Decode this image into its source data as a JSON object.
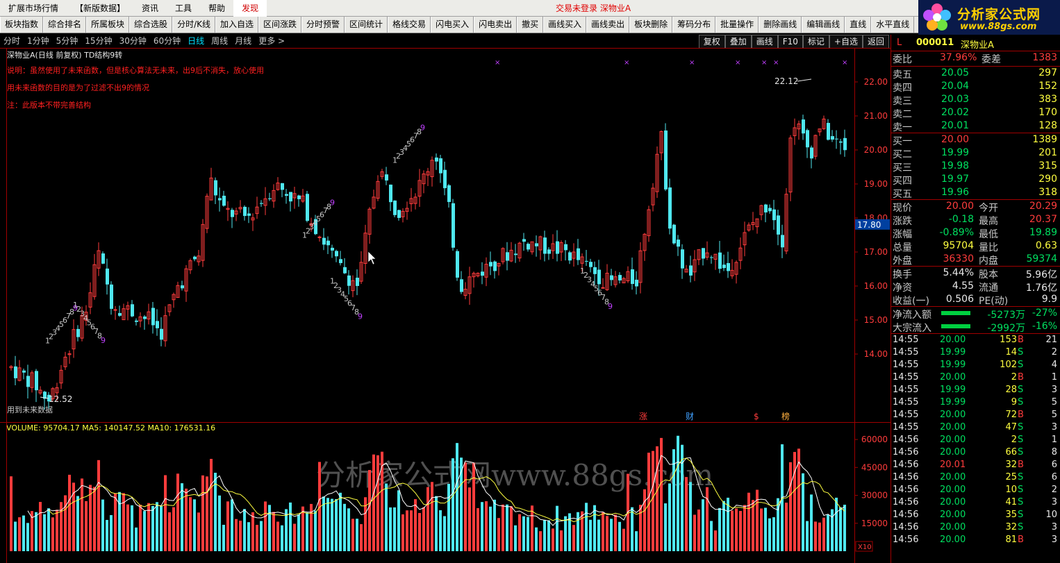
{
  "menubar": {
    "items": [
      "扩展市场行情",
      "【新版数据】",
      "资讯",
      "工具",
      "帮助",
      "发现"
    ],
    "status": "交易未登录   深物业A"
  },
  "logo": {
    "title": "分析家公式网",
    "url": "www.88gs.com"
  },
  "toolbar": [
    "板块指数",
    "综合排名",
    "所属板块",
    "综合选股",
    "分时/K线",
    "加入自选",
    "区间涨跌",
    "分时预警",
    "区间统计",
    "格线交易",
    "闪电买入",
    "闪电卖出",
    "撤买",
    "画线买入",
    "画线卖出",
    "板块删除",
    "筹码分布",
    "批量操作",
    "删除画线",
    "编辑画线",
    "直线",
    "水平直线"
  ],
  "periods": [
    "分时",
    "1分钟",
    "5分钟",
    "15分钟",
    "30分钟",
    "60分钟",
    "日线",
    "周线",
    "月线",
    "更多 >"
  ],
  "active_period": "日线",
  "right_buttons": [
    "复权",
    "叠加",
    "画线",
    "F10",
    "标记",
    "+自选",
    "返回"
  ],
  "chart": {
    "stock_title": "深物业A(日线 前复权) TD结构9转",
    "note1": "说明：虽然使用了未来函数，但是核心算法无未来，出9后不消失，放心使用",
    "note2": "用未来函数的目的是为了过滤不出9的情况",
    "note3": "注：此版本不带完善结构",
    "footer_note": "用到未来数据",
    "high_label": "22.12",
    "low_label": "12.52",
    "current_price_tag": "17.80",
    "price_axis": [
      "22.00",
      "21.00",
      "20.00",
      "19.00",
      "18.00",
      "17.00",
      "16.00",
      "15.00",
      "14.00"
    ],
    "event_marks": [
      "涨",
      "财",
      "$",
      "榜"
    ],
    "volume_legend": "VOLUME: 95704.17  MA5: 140147.52  MA10: 176531.16",
    "volume_axis": [
      "60000",
      "45000",
      "30000",
      "15000"
    ],
    "volume_unit": "X10",
    "watermark": "分析家公式网www.88gs.com",
    "colors": {
      "up": "#ff3c3c",
      "down": "#4fe8f0",
      "ma5": "#ffffff",
      "ma10": "#ffff40",
      "tdnum": "#c8c8c8",
      "td9": "#c040ff"
    }
  },
  "quote": {
    "L": "L",
    "code": "000011",
    "name": "深物业A",
    "weibi": {
      "label": "委比",
      "value": "37.96%",
      "label2": "委差",
      "value2": "1383"
    },
    "sells": [
      {
        "label": "卖五",
        "price": "20.05",
        "vol": "297"
      },
      {
        "label": "卖四",
        "price": "20.04",
        "vol": "152"
      },
      {
        "label": "卖三",
        "price": "20.03",
        "vol": "383"
      },
      {
        "label": "卖二",
        "price": "20.02",
        "vol": "170"
      },
      {
        "label": "卖一",
        "price": "20.01",
        "vol": "128"
      }
    ],
    "buys": [
      {
        "label": "买一",
        "price": "20.00",
        "vol": "1389"
      },
      {
        "label": "买二",
        "price": "19.99",
        "vol": "201"
      },
      {
        "label": "买三",
        "price": "19.98",
        "vol": "315"
      },
      {
        "label": "买四",
        "price": "19.97",
        "vol": "290"
      },
      {
        "label": "买五",
        "price": "19.96",
        "vol": "318"
      }
    ],
    "stats": [
      {
        "l1": "现价",
        "v1": "20.00",
        "c1": "red",
        "l2": "今开",
        "v2": "20.29",
        "c2": "red"
      },
      {
        "l1": "涨跌",
        "v1": "-0.18",
        "c1": "grn",
        "l2": "最高",
        "v2": "20.37",
        "c2": "red"
      },
      {
        "l1": "涨幅",
        "v1": "-0.89%",
        "c1": "grn",
        "l2": "最低",
        "v2": "19.89",
        "c2": "grn"
      },
      {
        "l1": "总量",
        "v1": "95704",
        "c1": "yel",
        "l2": "量比",
        "v2": "0.63",
        "c2": "yel"
      },
      {
        "l1": "外盘",
        "v1": "36330",
        "c1": "red",
        "l2": "内盘",
        "v2": "59374",
        "c2": "grn"
      }
    ],
    "stats2": [
      {
        "l1": "换手",
        "v1": "5.44%",
        "l2": "股本",
        "v2": "5.96亿"
      },
      {
        "l1": "净资",
        "v1": "4.55",
        "l2": "流通",
        "v2": "1.76亿"
      },
      {
        "l1": "收益(一)",
        "v1": "0.506",
        "l2": "PE(动)",
        "v2": "9.9"
      }
    ],
    "flows": [
      {
        "label": "净流入额",
        "value": "-5273万",
        "pct": "-27%"
      },
      {
        "label": "大宗流入",
        "value": "-2992万",
        "pct": "-16%"
      }
    ],
    "ticks": [
      {
        "t": "14:55",
        "p": "20.00",
        "v": "153",
        "bs": "B",
        "n": "21"
      },
      {
        "t": "14:55",
        "p": "19.99",
        "v": "14",
        "bs": "S",
        "n": "2"
      },
      {
        "t": "14:55",
        "p": "19.99",
        "v": "102",
        "bs": "S",
        "n": "4"
      },
      {
        "t": "14:55",
        "p": "20.00",
        "v": "2",
        "bs": "B",
        "n": "1"
      },
      {
        "t": "14:55",
        "p": "19.99",
        "v": "28",
        "bs": "S",
        "n": "3"
      },
      {
        "t": "14:55",
        "p": "19.99",
        "v": "9",
        "bs": "S",
        "n": "5"
      },
      {
        "t": "14:55",
        "p": "20.00",
        "v": "72",
        "bs": "B",
        "n": "5"
      },
      {
        "t": "14:55",
        "p": "20.00",
        "v": "47",
        "bs": "S",
        "n": "3"
      },
      {
        "t": "14:56",
        "p": "20.00",
        "v": "2",
        "bs": "S",
        "n": "1"
      },
      {
        "t": "14:56",
        "p": "20.00",
        "v": "66",
        "bs": "S",
        "n": "8"
      },
      {
        "t": "14:56",
        "p": "20.01",
        "v": "32",
        "bs": "B",
        "n": "6"
      },
      {
        "t": "14:56",
        "p": "20.00",
        "v": "25",
        "bs": "S",
        "n": "6"
      },
      {
        "t": "14:56",
        "p": "20.00",
        "v": "10",
        "bs": "S",
        "n": "2"
      },
      {
        "t": "14:56",
        "p": "20.00",
        "v": "41",
        "bs": "S",
        "n": "3"
      },
      {
        "t": "14:56",
        "p": "20.00",
        "v": "35",
        "bs": "S",
        "n": "10"
      },
      {
        "t": "14:56",
        "p": "20.00",
        "v": "32",
        "bs": "S",
        "n": "3"
      },
      {
        "t": "14:56",
        "p": "20.00",
        "v": "81",
        "bs": "B",
        "n": "3"
      }
    ]
  }
}
